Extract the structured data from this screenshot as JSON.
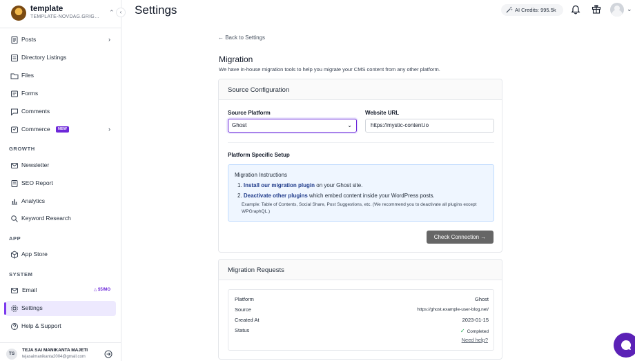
{
  "workspace": {
    "name": "template",
    "sub": "TEMPLATE-NOVDAG.GRIGOR..."
  },
  "sidebar": {
    "items": [
      {
        "label": "Posts"
      },
      {
        "label": "Directory Listings"
      },
      {
        "label": "Files"
      },
      {
        "label": "Forms"
      },
      {
        "label": "Comments"
      },
      {
        "label": "Commerce",
        "badge": "NEW"
      }
    ],
    "growth_label": "GROWTH",
    "growth": [
      {
        "label": "Newsletter"
      },
      {
        "label": "SEO Report"
      },
      {
        "label": "Analytics"
      },
      {
        "label": "Keyword Research"
      }
    ],
    "app_label": "APP",
    "app": [
      {
        "label": "App Store"
      }
    ],
    "system_label": "SYSTEM",
    "system": [
      {
        "label": "Email",
        "price": "$5/MO"
      },
      {
        "label": "Settings"
      },
      {
        "label": "Help & Support"
      }
    ],
    "user": {
      "initials": "TS",
      "name": "TEJA SAI MANIKANTA MAJETI",
      "email": "tejasaimanikanta2004@gmail.com"
    }
  },
  "header": {
    "title": "Settings",
    "credits": "AI Credits: 995.5k"
  },
  "main": {
    "back": "← Back to Settings",
    "title": "Migration",
    "description": "We have in-house migration tools to help you migrate your CMS content from any other platform.",
    "source_config": {
      "heading": "Source Configuration",
      "platform_label": "Source Platform",
      "platform_value": "Ghost",
      "url_label": "Website URL",
      "url_value": "https://mystic-content.io",
      "setup_label": "Platform Specific Setup",
      "instructions": {
        "title": "Migration Instructions",
        "step1_num": "1.",
        "step1_bold": "Install our migration plugin",
        "step1_rest": " on your Ghost site.",
        "step2_num": "2.",
        "step2_bold": "Deactivate other plugins",
        "step2_rest": " which embed content inside your WordPress posts.",
        "note": "Example: Table of Contents, Social Share, Post Suggestions, etc. (We recommend you to deactivate all plugins except WPGraphQL.)"
      },
      "check_button": "Check Connection →"
    },
    "requests": {
      "heading": "Migration Requests",
      "rows": [
        {
          "k": "Platform",
          "v": "Ghost"
        },
        {
          "k": "Source",
          "v": "https://ghost.example-user-blog.net/"
        },
        {
          "k": "Created At",
          "v": "2023-01-15"
        },
        {
          "k": "Status",
          "v": "Completed"
        }
      ],
      "help": "Need help?"
    }
  }
}
